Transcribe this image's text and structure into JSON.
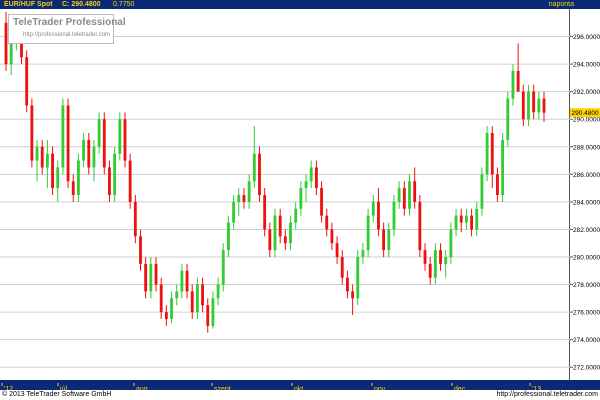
{
  "header": {
    "symbol": "EUR/HUF Spot",
    "close_label": "C: 290.4800",
    "change": "0.7750",
    "period": "naponta"
  },
  "logo": {
    "brand": "TeleTrader Professional",
    "url": "http://professional.teletrader.com"
  },
  "footer": {
    "copyright": "© 2013 TeleTrader Software GmbH",
    "url": "http://professional.teletrader.com"
  },
  "colors": {
    "up": "#33cc33",
    "down": "#ee1111",
    "header_bg": "#0a2a78",
    "grid": "#cfcfcf",
    "last_price_bg": "#ffd700"
  },
  "chart_data": {
    "type": "candlestick",
    "title": "EUR/HUF Spot",
    "ylim": [
      271,
      298
    ],
    "yticks": [
      "272.0000",
      "274.0000",
      "276.0000",
      "278.0000",
      "280.0000",
      "282.0000",
      "284.0000",
      "286.0000",
      "288.0000",
      "290.0000",
      "292.0000",
      "294.0000",
      "296.0000"
    ],
    "last_price": "290.4800",
    "xticks": [
      "'12",
      "júl.",
      "aug.",
      "szept.",
      "okt.",
      "nov.",
      "dec.",
      "'13"
    ],
    "grid": true,
    "candles": [
      [
        297.0,
        297.8,
        293.5,
        294.0
      ],
      [
        294.0,
        296.0,
        293.2,
        295.5
      ],
      [
        295.5,
        297.5,
        295.0,
        297.0
      ],
      [
        297.0,
        297.5,
        294.0,
        294.5
      ],
      [
        294.5,
        295.0,
        290.5,
        291.0
      ],
      [
        291.0,
        291.5,
        286.5,
        287.0
      ],
      [
        287.0,
        288.5,
        285.5,
        288.0
      ],
      [
        288.0,
        288.5,
        286.0,
        286.5
      ],
      [
        286.5,
        288.5,
        285.0,
        287.5
      ],
      [
        287.5,
        288.0,
        284.5,
        285.0
      ],
      [
        285.0,
        287.0,
        284.0,
        286.5
      ],
      [
        286.5,
        291.5,
        286.0,
        291.0
      ],
      [
        291.0,
        291.5,
        285.0,
        285.5
      ],
      [
        285.5,
        286.0,
        284.0,
        284.5
      ],
      [
        284.5,
        287.5,
        284.0,
        287.0
      ],
      [
        287.0,
        289.0,
        286.5,
        288.5
      ],
      [
        288.5,
        289.0,
        286.0,
        286.5
      ],
      [
        286.5,
        288.5,
        285.5,
        288.0
      ],
      [
        288.0,
        290.5,
        287.5,
        290.0
      ],
      [
        290.0,
        290.5,
        286.0,
        286.5
      ],
      [
        286.5,
        287.0,
        284.0,
        284.5
      ],
      [
        284.5,
        288.0,
        284.0,
        287.5
      ],
      [
        287.5,
        290.5,
        287.0,
        290.0
      ],
      [
        290.0,
        290.5,
        286.5,
        287.0
      ],
      [
        287.0,
        287.5,
        283.5,
        284.0
      ],
      [
        284.0,
        284.5,
        281.0,
        281.5
      ],
      [
        281.5,
        282.0,
        279.0,
        279.5
      ],
      [
        279.5,
        280.0,
        277.0,
        277.5
      ],
      [
        277.5,
        280.0,
        277.0,
        279.5
      ],
      [
        279.5,
        280.0,
        277.5,
        278.0
      ],
      [
        278.0,
        278.5,
        275.5,
        276.0
      ],
      [
        276.0,
        276.5,
        275.0,
        275.5
      ],
      [
        275.5,
        277.5,
        275.2,
        277.0
      ],
      [
        277.0,
        278.0,
        276.5,
        277.5
      ],
      [
        277.5,
        279.5,
        277.0,
        279.0
      ],
      [
        279.0,
        279.5,
        277.0,
        277.5
      ],
      [
        277.5,
        278.0,
        275.5,
        276.0
      ],
      [
        276.0,
        278.5,
        275.5,
        278.0
      ],
      [
        278.0,
        278.5,
        276.0,
        276.5
      ],
      [
        276.5,
        277.0,
        274.5,
        275.0
      ],
      [
        275.0,
        277.5,
        274.8,
        277.0
      ],
      [
        277.0,
        278.5,
        276.5,
        278.0
      ],
      [
        278.0,
        281.0,
        277.5,
        280.5
      ],
      [
        280.5,
        283.0,
        280.0,
        282.5
      ],
      [
        282.5,
        284.5,
        282.0,
        284.0
      ],
      [
        284.0,
        285.0,
        283.0,
        284.5
      ],
      [
        284.5,
        285.0,
        283.5,
        284.0
      ],
      [
        284.0,
        286.0,
        283.5,
        285.5
      ],
      [
        285.5,
        289.5,
        285.0,
        287.5
      ],
      [
        287.5,
        288.0,
        284.0,
        284.5
      ],
      [
        284.5,
        285.0,
        281.5,
        282.0
      ],
      [
        282.0,
        282.5,
        280.0,
        280.5
      ],
      [
        280.5,
        283.5,
        280.0,
        283.0
      ],
      [
        283.0,
        283.5,
        281.0,
        281.5
      ],
      [
        281.5,
        282.0,
        280.5,
        281.0
      ],
      [
        281.0,
        283.0,
        280.5,
        282.5
      ],
      [
        282.5,
        284.0,
        282.0,
        283.5
      ],
      [
        283.5,
        285.5,
        283.0,
        285.0
      ],
      [
        285.0,
        286.0,
        284.0,
        285.5
      ],
      [
        285.5,
        287.0,
        285.0,
        286.5
      ],
      [
        286.5,
        287.0,
        284.5,
        285.0
      ],
      [
        285.0,
        285.5,
        282.5,
        283.0
      ],
      [
        283.0,
        283.5,
        281.5,
        282.0
      ],
      [
        282.0,
        282.5,
        280.5,
        281.0
      ],
      [
        281.0,
        281.5,
        279.5,
        280.0
      ],
      [
        280.0,
        280.5,
        278.0,
        278.5
      ],
      [
        278.5,
        279.0,
        277.0,
        277.5
      ],
      [
        277.5,
        278.0,
        275.8,
        277.0
      ],
      [
        277.0,
        280.5,
        276.5,
        280.0
      ],
      [
        280.0,
        281.0,
        279.5,
        280.5
      ],
      [
        280.5,
        283.5,
        280.0,
        283.0
      ],
      [
        283.0,
        284.5,
        282.5,
        284.0
      ],
      [
        284.0,
        285.0,
        281.5,
        282.0
      ],
      [
        282.0,
        282.5,
        280.0,
        280.5
      ],
      [
        280.5,
        282.5,
        280.0,
        282.0
      ],
      [
        282.0,
        284.5,
        281.5,
        284.0
      ],
      [
        284.0,
        285.5,
        283.5,
        285.0
      ],
      [
        285.0,
        285.5,
        283.0,
        283.5
      ],
      [
        283.5,
        286.0,
        283.0,
        285.5
      ],
      [
        285.5,
        286.5,
        283.5,
        284.0
      ],
      [
        284.0,
        284.5,
        280.0,
        280.5
      ],
      [
        280.5,
        281.0,
        279.0,
        279.5
      ],
      [
        279.5,
        280.0,
        278.0,
        278.5
      ],
      [
        278.5,
        281.0,
        278.0,
        280.5
      ],
      [
        280.5,
        281.0,
        279.0,
        279.5
      ],
      [
        279.5,
        280.5,
        278.5,
        280.0
      ],
      [
        280.0,
        282.5,
        279.5,
        282.0
      ],
      [
        282.0,
        283.5,
        281.5,
        283.0
      ],
      [
        283.0,
        283.5,
        281.8,
        282.5
      ],
      [
        282.5,
        283.5,
        282.0,
        283.0
      ],
      [
        283.0,
        283.5,
        281.5,
        282.0
      ],
      [
        282.0,
        284.0,
        281.5,
        283.5
      ],
      [
        283.5,
        286.5,
        283.0,
        286.0
      ],
      [
        286.0,
        289.5,
        285.5,
        289.0
      ],
      [
        289.0,
        289.5,
        285.0,
        286.0
      ],
      [
        286.0,
        286.5,
        284.0,
        284.5
      ],
      [
        284.5,
        289.0,
        284.0,
        288.5
      ],
      [
        288.5,
        292.0,
        288.0,
        291.5
      ],
      [
        291.5,
        294.0,
        291.0,
        293.5
      ],
      [
        293.5,
        295.5,
        293.0,
        292.0
      ],
      [
        292.0,
        292.5,
        289.5,
        290.0
      ],
      [
        290.0,
        292.5,
        289.5,
        292.0
      ],
      [
        292.0,
        292.5,
        290.0,
        290.5
      ],
      [
        290.5,
        292.0,
        290.0,
        291.5
      ],
      [
        291.5,
        292.0,
        289.8,
        290.48
      ]
    ]
  }
}
